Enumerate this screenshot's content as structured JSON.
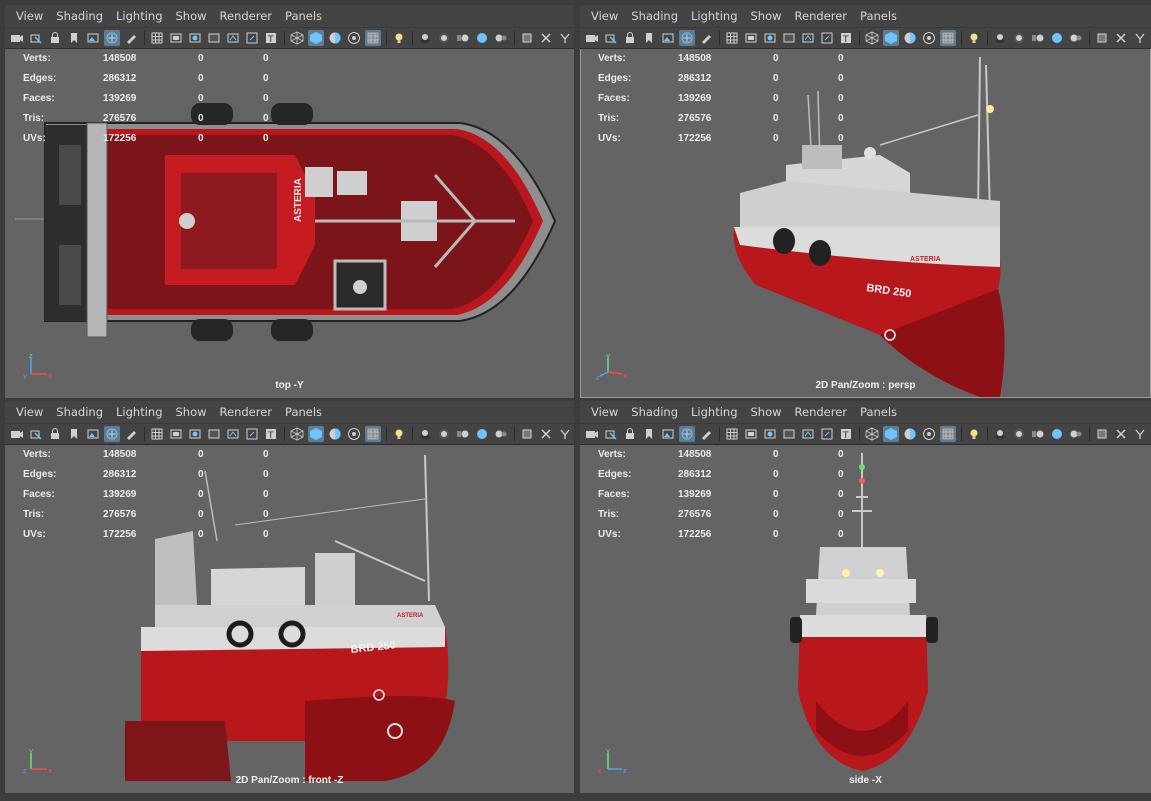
{
  "menus": [
    "View",
    "Shading",
    "Lighting",
    "Show",
    "Renderer",
    "Panels"
  ],
  "hud": {
    "rows": [
      {
        "label": "Verts:",
        "v1": "148508",
        "v2": "0",
        "v3": "0"
      },
      {
        "label": "Edges:",
        "v1": "286312",
        "v2": "0",
        "v3": "0"
      },
      {
        "label": "Faces:",
        "v1": "139269",
        "v2": "0",
        "v3": "0"
      },
      {
        "label": "Tris:",
        "v1": "276576",
        "v2": "0",
        "v3": "0"
      },
      {
        "label": "UVs:",
        "v1": "172256",
        "v2": "0",
        "v3": "0"
      }
    ]
  },
  "viewports": {
    "top": {
      "camera_label": "top -Y"
    },
    "persp": {
      "camera_label": "2D Pan/Zoom : persp"
    },
    "front": {
      "camera_label": "2D Pan/Zoom : front -Z"
    },
    "side": {
      "camera_label": "side -X"
    }
  },
  "model": {
    "name": "ASTERIA",
    "registration": "BRD 250"
  },
  "colors": {
    "viewport_bg": "#646464",
    "menubar_bg": "#444444",
    "hull_red": "#b11a1c",
    "deck_red": "#7a1518",
    "superstructure": "#d8d8d8",
    "accent": "#5e7d92"
  },
  "icons": [
    "camera-icon",
    "select-camera-icon",
    "lock-camera-icon",
    "bookmark-icon",
    "image-plane-icon",
    "pan-zoom-icon",
    "grease-pencil-icon",
    "grid-icon",
    "film-gate-icon",
    "resolution-gate-icon",
    "gate-mask-icon",
    "field-chart-icon",
    "safe-action-icon",
    "safe-title-icon",
    "wireframe-icon",
    "smooth-shade-icon",
    "default-material-icon",
    "xray-icon",
    "xray-joints-icon",
    "lights-icon",
    "shadows-icon",
    "ambient-occlusion-icon",
    "motion-blur-icon",
    "antialias-icon",
    "depth-of-field-icon",
    "isolate-icon",
    "xray-active-icon",
    "gamma-icon"
  ]
}
